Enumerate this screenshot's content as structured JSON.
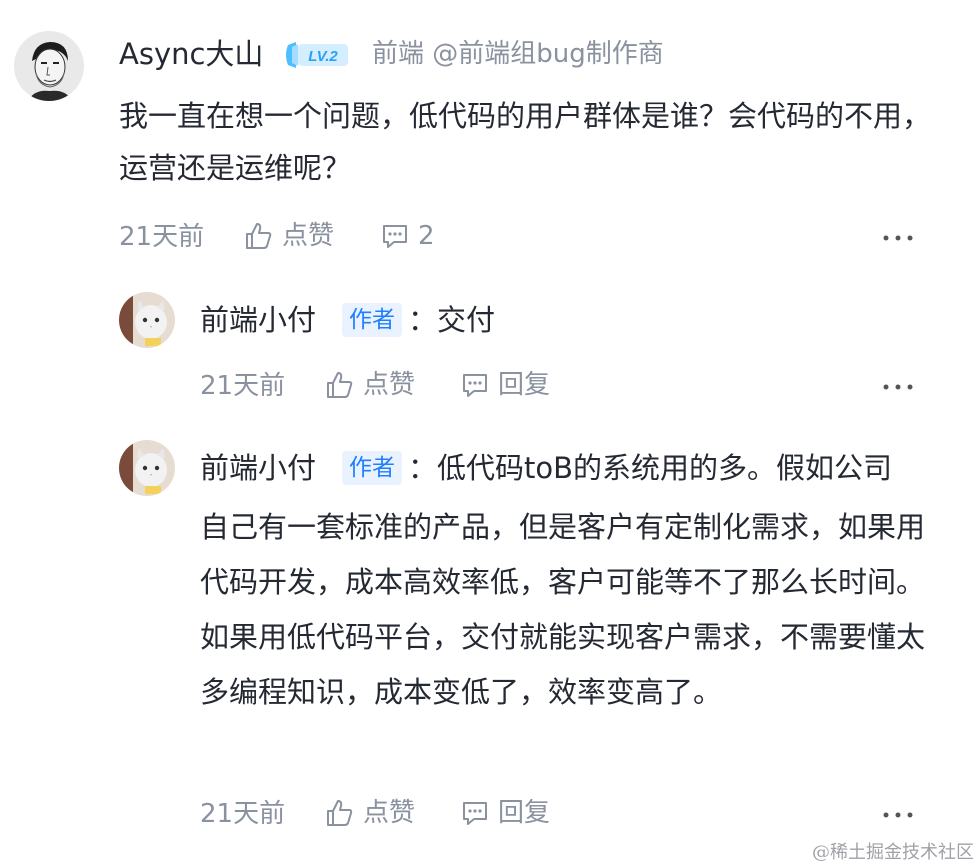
{
  "main_comment": {
    "username": "Async大山",
    "level": "LV.2",
    "job": "前端 @前端组bug制作商",
    "content": "我一直在想一个问题，低代码的用户群体是谁？会代码的不用，运营还是运维呢？",
    "time": "21天前",
    "like_label": "点赞",
    "reply_count": "2"
  },
  "replies": [
    {
      "username": "前端小付",
      "badge": "作者",
      "separator": "：",
      "content": "交付",
      "time": "21天前",
      "like_label": "点赞",
      "reply_label": "回复"
    },
    {
      "username": "前端小付",
      "badge": "作者",
      "separator": "：",
      "content_line1": "低代码toB的系统用的多。假如公司",
      "content_rest": "自己有一套标准的产品，但是客户有定制化需求，如果用代码开发，成本高效率低，客户可能等不了那么长时间。如果用低代码平台，交付就能实现客户需求，不需要懂太多编程知识，成本变低了，效率变高了。",
      "time": "21天前",
      "like_label": "点赞",
      "reply_label": "回复"
    }
  ],
  "watermark": "@稀土掘金技术社区",
  "colors": {
    "accent": "#1e80ff",
    "text": "#252933",
    "muted": "#8a919f",
    "badge_bg": "#eaf2ff"
  }
}
